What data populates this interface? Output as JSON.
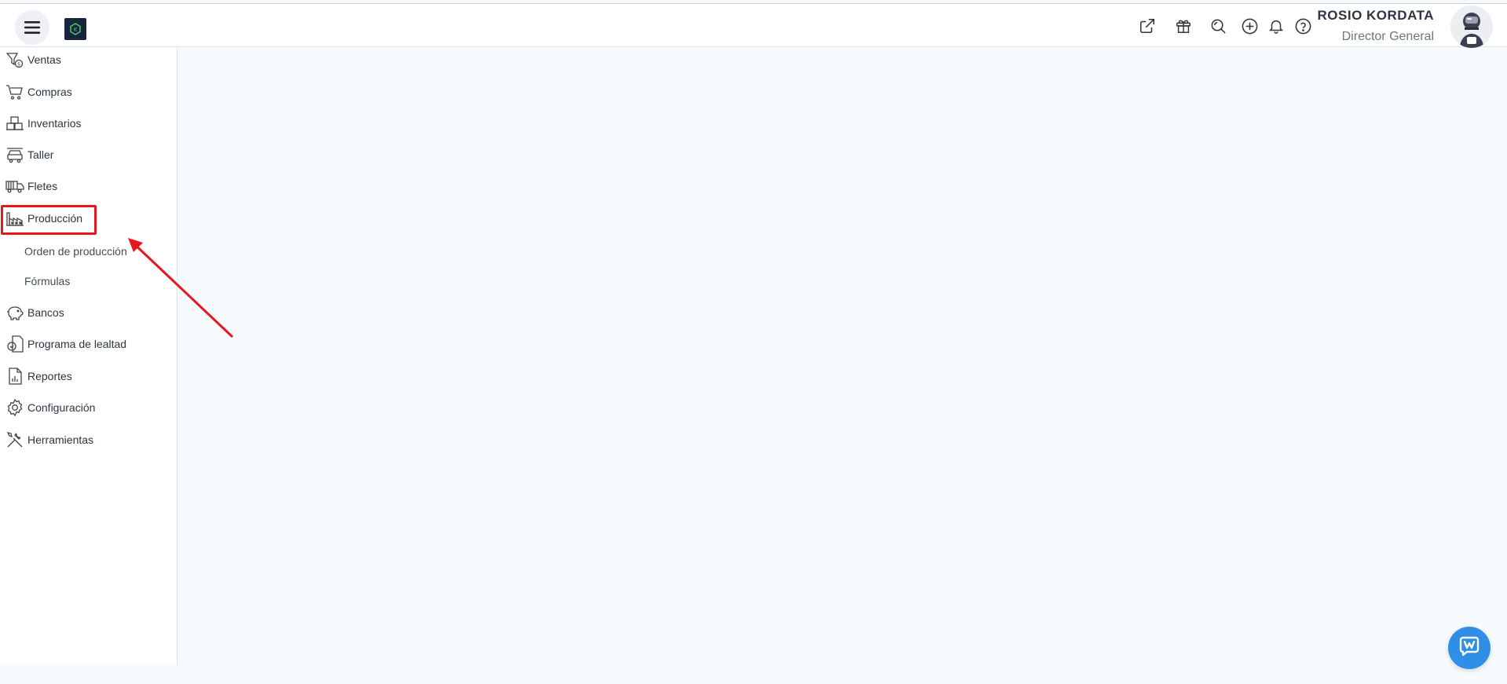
{
  "header": {
    "menu_icon": "hamburger-icon",
    "logo": "app-logo",
    "icons": [
      "external-link-icon",
      "gift-icon",
      "search-icon",
      "add-circle-icon",
      "bell-icon",
      "help-icon"
    ],
    "user": {
      "name": "ROSIO KORDATA",
      "role": "Director General"
    }
  },
  "sidebar": {
    "items": [
      {
        "label": "Ventas",
        "icon": "sales-icon"
      },
      {
        "label": "Compras",
        "icon": "cart-icon"
      },
      {
        "label": "Inventarios",
        "icon": "boxes-icon"
      },
      {
        "label": "Taller",
        "icon": "car-icon"
      },
      {
        "label": "Fletes",
        "icon": "truck-icon"
      },
      {
        "label": "Producción",
        "icon": "factory-icon",
        "sub_items": [
          "Orden de producción",
          "Fórmulas"
        ]
      },
      {
        "label": "Bancos",
        "icon": "piggy-bank-icon"
      },
      {
        "label": "Programa de lealtad",
        "icon": "loyalty-icon"
      },
      {
        "label": "Reportes",
        "icon": "report-icon"
      },
      {
        "label": "Configuración",
        "icon": "gear-icon"
      },
      {
        "label": "Herramientas",
        "icon": "tools-icon"
      }
    ]
  },
  "colors": {
    "highlight": "#e8161d",
    "chat": "#2f8ee6",
    "logo_bg": "#17263a",
    "logo_accent": "#4fd16a"
  },
  "chat": {
    "icon": "chat-icon"
  }
}
